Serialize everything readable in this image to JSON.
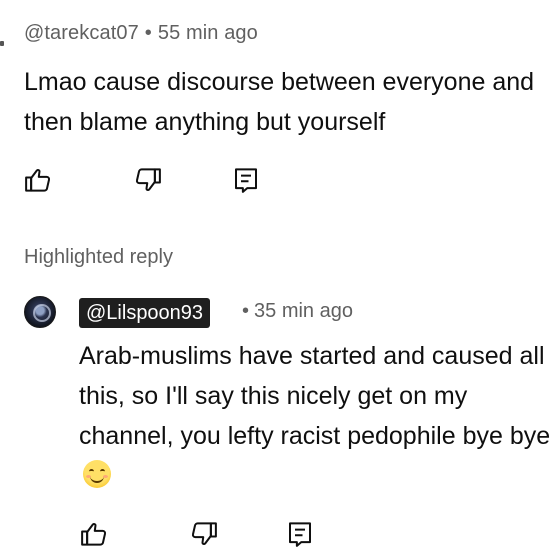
{
  "comment": {
    "author": "@tarekcat07",
    "separator": "•",
    "time": "55 min ago",
    "text_line1": "Lmao cause discourse between everyone and",
    "text_line2": "then blame anything but yourself",
    "actions": {
      "like_icon": "thumbs-up-icon",
      "dislike_icon": "thumbs-down-icon",
      "reply_icon": "reply-comment-icon"
    }
  },
  "highlighted_label": "Highlighted reply",
  "reply": {
    "avatar_icon": "user-avatar",
    "author": "@Lilspoon93",
    "separator": "•",
    "time": "35 min ago",
    "text": "Arab-muslims have started and caused all this, so I'll say this nicely get on my channel, you lefty racist pedophile bye bye",
    "emoji": "smiling-face-emoji",
    "actions": {
      "like_icon": "thumbs-up-icon",
      "dislike_icon": "thumbs-down-icon",
      "reply_icon": "reply-comment-icon"
    }
  },
  "colors": {
    "text": "#0f0f0f",
    "meta": "#606060",
    "author_chip_bg": "#1f1f1f",
    "author_chip_text": "#ffffff"
  }
}
